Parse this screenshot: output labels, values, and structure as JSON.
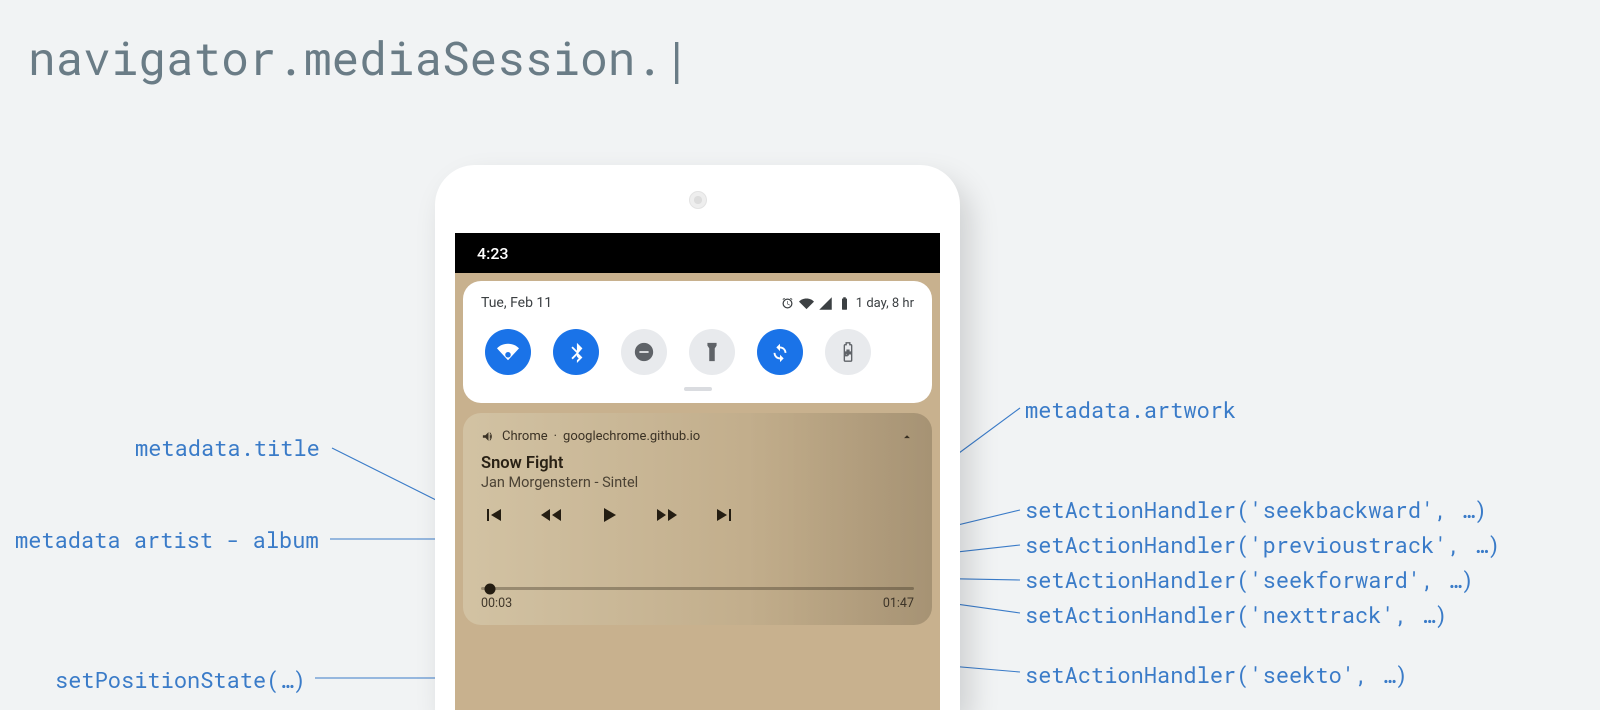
{
  "heading": "navigator.mediaSession.|",
  "phone": {
    "status_time": "4:23",
    "qs": {
      "date": "Tue, Feb 11",
      "battery_text": "1 day, 8 hr"
    },
    "media": {
      "source_app": "Chrome",
      "source_sep": " · ",
      "source_domain": "googlechrome.github.io",
      "title": "Snow Fight",
      "subtitle": "Jan Morgenstern - Sintel",
      "time_current": "00:03",
      "time_total": "01:47"
    }
  },
  "annotations": {
    "left": {
      "title": "metadata.title",
      "artist_album": "metadata artist - album",
      "position": "setPositionState(…)"
    },
    "right": {
      "artwork": "metadata.artwork",
      "seekbackward": "setActionHandler('seekbackward', …)",
      "previoustrack": "setActionHandler('previoustrack', …)",
      "seekforward": "setActionHandler('seekforward', …)",
      "nexttrack": "setActionHandler('nexttrack', …)",
      "seekto": "setActionHandler('seekto', …)"
    }
  }
}
